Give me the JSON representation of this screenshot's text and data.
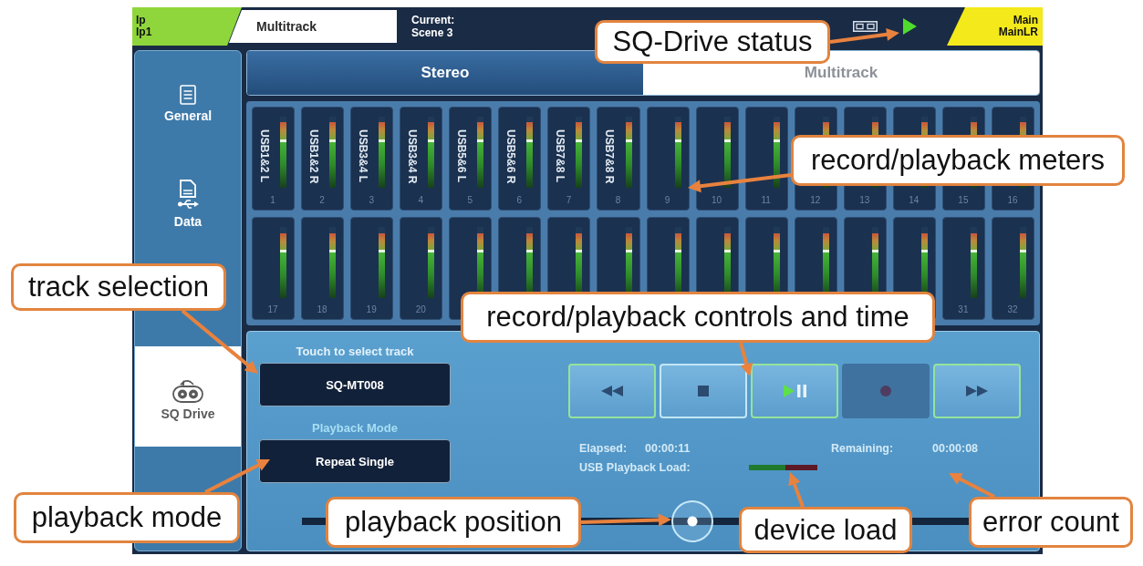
{
  "top_bar": {
    "channel": {
      "label": "Ip",
      "name": "Ip1"
    },
    "screen": "Multitrack",
    "scene": {
      "label": "Current:",
      "name": "Scene 3"
    },
    "drive_status": {
      "playing": true
    },
    "mix": {
      "label": "Main",
      "name": "MainLR"
    }
  },
  "sidebar": {
    "items": [
      {
        "label": "General",
        "selected": false
      },
      {
        "label": "Data",
        "selected": false
      },
      {
        "label": "SQ Drive",
        "selected": true
      }
    ]
  },
  "tabs": [
    {
      "label": "Stereo",
      "selected": false
    },
    {
      "label": "Multitrack",
      "selected": true
    }
  ],
  "meters": {
    "channels": [
      {
        "label": "USB1&2 L",
        "number": "1",
        "level": 0.92
      },
      {
        "label": "USB1&2 R",
        "number": "2",
        "level": 0.92
      },
      {
        "label": "USB3&4 L",
        "number": "3",
        "level": 0.92
      },
      {
        "label": "USB3&4 R",
        "number": "4",
        "level": 0.92
      },
      {
        "label": "USB5&6 L",
        "number": "5",
        "level": 0.92
      },
      {
        "label": "USB5&6 R",
        "number": "6",
        "level": 0.92
      },
      {
        "label": "USB7&8 L",
        "number": "7",
        "level": 0.92
      },
      {
        "label": "USB7&8 R",
        "number": "8",
        "level": 0.92
      },
      {
        "number": "9",
        "level": 0.92
      },
      {
        "number": "10",
        "level": 0.92
      },
      {
        "number": "11",
        "level": 0.92
      },
      {
        "number": "12",
        "level": 0.92
      },
      {
        "number": "13",
        "level": 0.92
      },
      {
        "number": "14",
        "level": 0.92
      },
      {
        "number": "15",
        "level": 0.92
      },
      {
        "number": "16",
        "level": 0.92
      },
      {
        "number": "17",
        "level": 0.9
      },
      {
        "number": "18",
        "level": 0.9
      },
      {
        "number": "19",
        "level": 0.9
      },
      {
        "number": "20",
        "level": 0.9
      },
      {
        "level": 0.9
      },
      {
        "level": 0.9
      },
      {
        "level": 0.9
      },
      {
        "level": 0.9
      },
      {
        "level": 0.9
      },
      {
        "level": 0.9
      },
      {
        "level": 0.9
      },
      {
        "level": 0.9
      },
      {
        "level": 0.9
      },
      {
        "level": 0.9
      },
      {
        "number": "31",
        "level": 0.9
      },
      {
        "number": "32",
        "level": 0.9
      }
    ]
  },
  "track_select": {
    "label": "Touch to select track",
    "value": "SQ-MT008"
  },
  "playback_mode": {
    "label": "Playback Mode",
    "value": "Repeat Single"
  },
  "transport": {
    "playing": true,
    "buttons": [
      {
        "kind": "rewind",
        "highlighted": true,
        "disabled": false
      },
      {
        "kind": "stop",
        "highlighted": false,
        "disabled": false
      },
      {
        "kind": "play_pause",
        "highlighted": true,
        "disabled": false
      },
      {
        "kind": "record",
        "highlighted": false,
        "disabled": true
      },
      {
        "kind": "fast_forward",
        "highlighted": true,
        "disabled": false
      }
    ]
  },
  "elapsed": {
    "label": "Elapsed:",
    "value": "00:00:11"
  },
  "remaining": {
    "label": "Remaining:",
    "value": "00:00:08"
  },
  "usb_load": {
    "label": "USB Playback Load:",
    "level": 0.53
  },
  "position": {
    "level": 0.57
  },
  "callouts": [
    "SQ-Drive status",
    "record/playback meters",
    "track selection",
    "record/playback controls and time",
    "playback mode",
    "playback position",
    "device load",
    "error count"
  ]
}
